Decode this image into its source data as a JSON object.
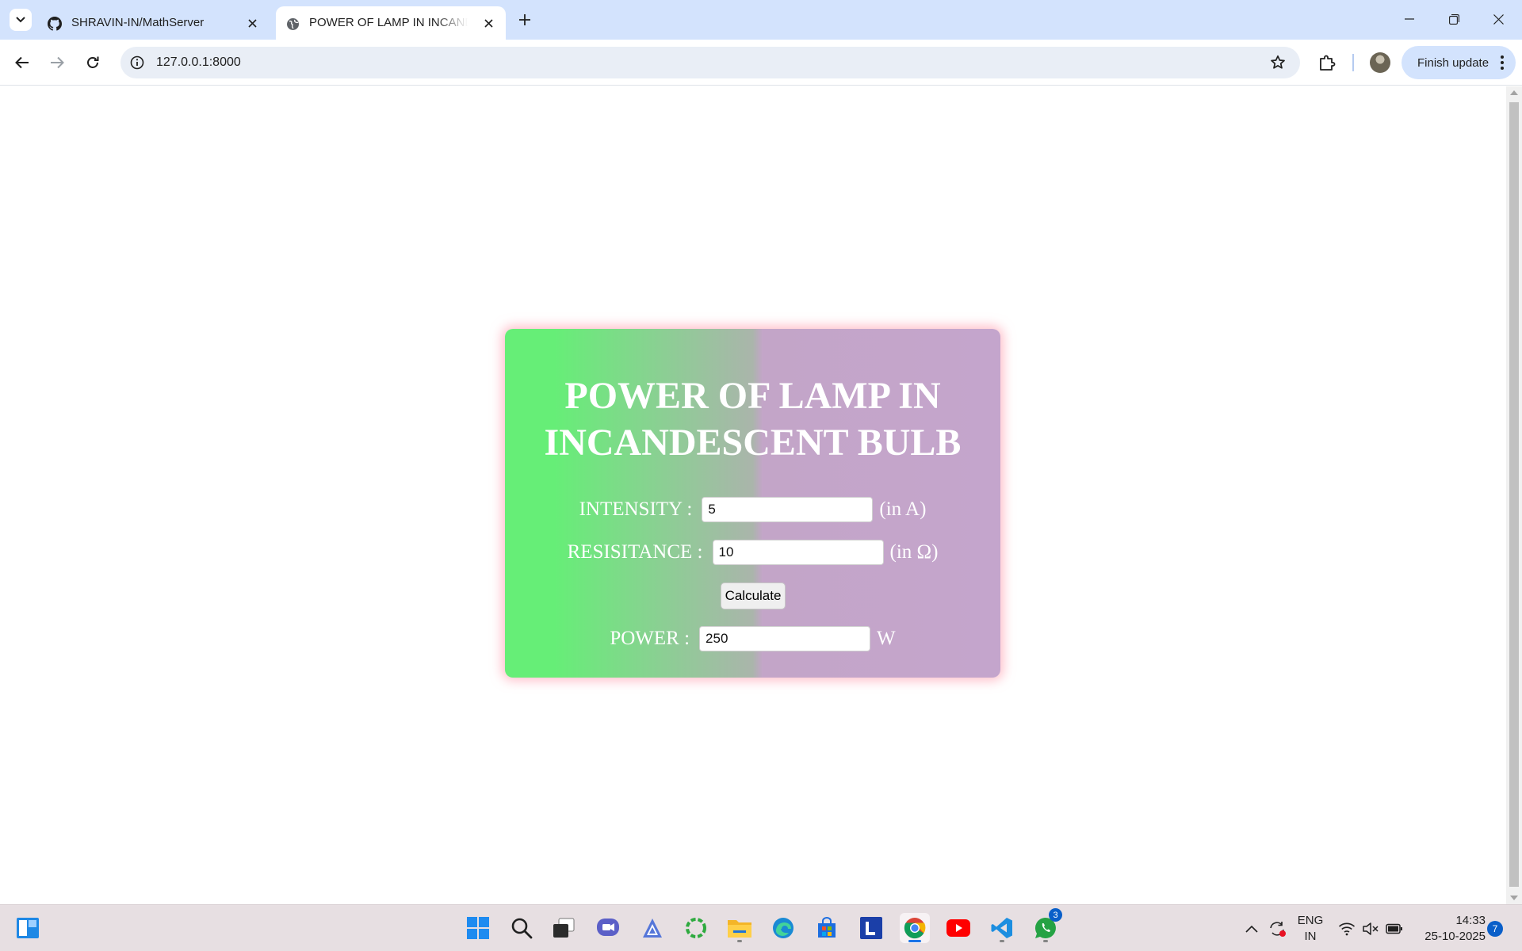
{
  "browser": {
    "tabs": [
      {
        "title": "SHRAVIN-IN/MathServer",
        "favicon": "github-icon",
        "active": false
      },
      {
        "title": "POWER OF LAMP IN INCANDESCENT BULB",
        "favicon": "globe-icon",
        "active": true
      }
    ],
    "url": "127.0.0.1:8000",
    "finish_update_label": "Finish update"
  },
  "page": {
    "heading_line1": "POWER OF LAMP IN",
    "heading_line2": "INCANDESCENT BULB",
    "intensity": {
      "label": "INTENSITY :",
      "value": "5",
      "unit": "(in A)"
    },
    "resistance": {
      "label": "RESISITANCE :",
      "value": "10",
      "unit": "(in Ω)"
    },
    "calculate_label": "Calculate",
    "power": {
      "label": "POWER :",
      "value": "250",
      "unit": "W"
    },
    "colors": {
      "gradient_start": "#66ee77",
      "gradient_end": "#c4a5cc",
      "glow": "#ff8ca0",
      "text": "#ffffff"
    }
  },
  "taskbar": {
    "apps": [
      "widgets-icon",
      "start-icon",
      "search-icon",
      "task-view-icon",
      "meet-icon",
      "app-icon",
      "copilot-icon",
      "file-explorer-icon",
      "edge-icon",
      "store-icon",
      "l-app-icon",
      "chrome-icon",
      "youtube-icon",
      "vscode-icon",
      "whatsapp-icon"
    ],
    "whatsapp_badge": "3",
    "language_line1": "ENG",
    "language_line2": "IN",
    "time": "14:33",
    "date": "25-10-2025",
    "notification_count": "7"
  }
}
